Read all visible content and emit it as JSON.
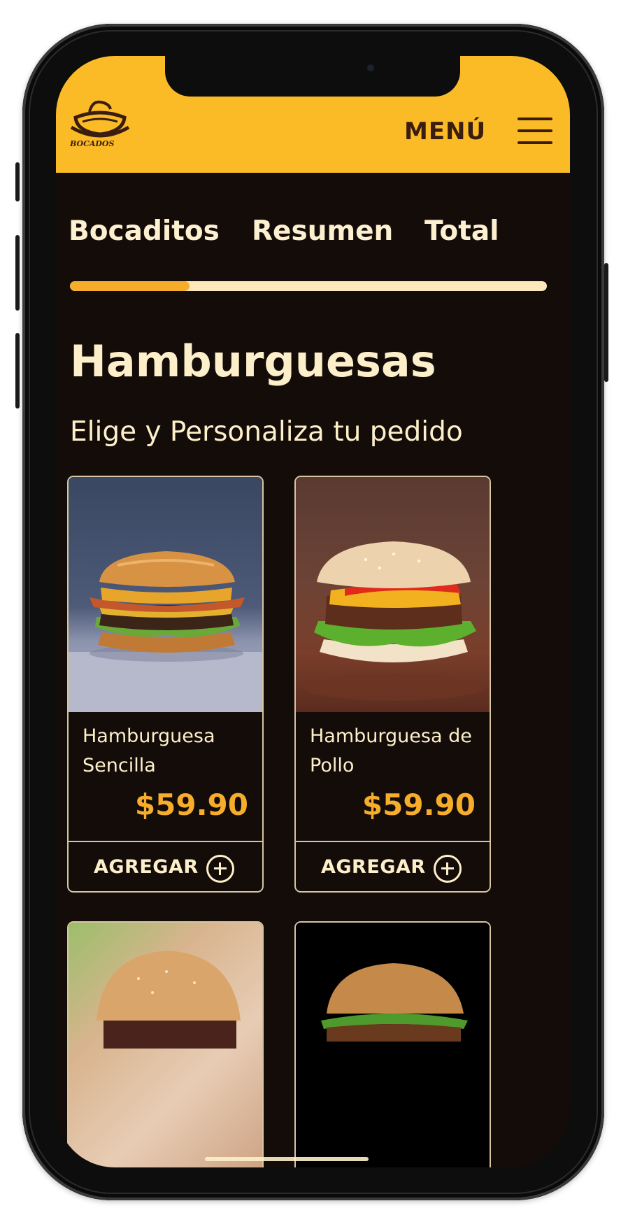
{
  "header": {
    "logo_text": "BOCADOS",
    "menu_label": "MENÚ"
  },
  "steps": {
    "items": [
      "Bocaditos",
      "Resumen",
      "Total"
    ],
    "progress": 0.25
  },
  "section": {
    "title": "Hamburguesas",
    "subtitle": "Elige y Personaliza tu pedido"
  },
  "products": [
    {
      "name": "Hamburguesa Sencilla",
      "price": "$59.90",
      "button_label": "AGREGAR",
      "image": "hamburger-photo"
    },
    {
      "name": "Hamburguesa de Pollo",
      "price": "$59.90",
      "button_label": "AGREGAR",
      "image": "hamburger-photo"
    },
    {
      "name": "",
      "price": "",
      "button_label": "",
      "image": "hamburger-photo"
    },
    {
      "name": "",
      "price": "",
      "button_label": "",
      "image": "hamburger-photo"
    }
  ],
  "colors": {
    "accent": "#fbbb27",
    "price": "#f6ad2c",
    "background": "#130c08",
    "text": "#fdefc9"
  },
  "icons": [
    "logo-icon",
    "hamburger-menu-icon",
    "plus-circle-icon"
  ]
}
